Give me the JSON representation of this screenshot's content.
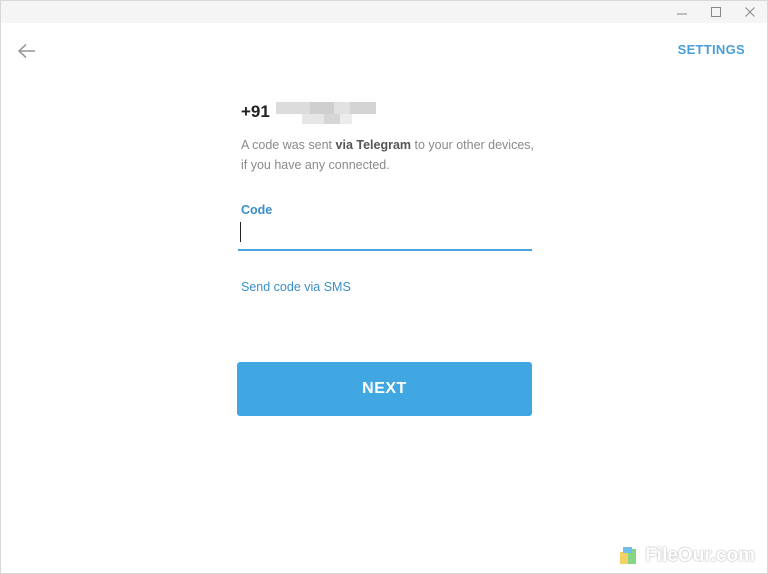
{
  "window": {
    "controls": {
      "minimize_icon": "minimize-icon",
      "maximize_icon": "maximize-icon",
      "close_icon": "close-icon"
    }
  },
  "header": {
    "back_icon": "arrow-left-icon",
    "settings_label": "SETTINGS"
  },
  "phone": {
    "prefix": "+91"
  },
  "info": {
    "text_before": "A code was sent ",
    "text_bold": "via Telegram",
    "text_after": " to your other devices, if you have any connected."
  },
  "code_field": {
    "label": "Code",
    "value": ""
  },
  "sms_link": "Send code via SMS",
  "next_button": "NEXT",
  "watermark": {
    "text": "FileOur.com"
  },
  "colors": {
    "accent": "#40a7e3",
    "link": "#3a8fc8",
    "muted_text": "#8a8a8a",
    "titlebar": "#f5f5f5"
  }
}
